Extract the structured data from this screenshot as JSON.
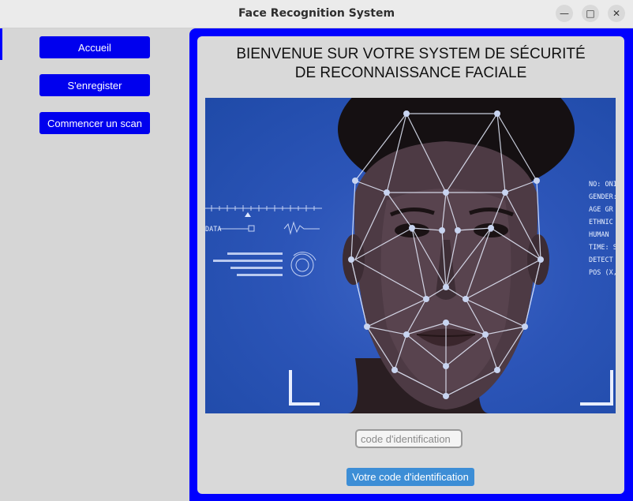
{
  "window": {
    "title": "Face Recognition System",
    "controls": [
      "minimize-icon",
      "maximize-icon",
      "close-icon"
    ]
  },
  "sidebar": {
    "items": [
      {
        "label": "Accueil"
      },
      {
        "label": "S'enregister"
      },
      {
        "label": "Commencer un scan"
      }
    ]
  },
  "main": {
    "heading_line1": "BIENVENUE SUR VOTRE SYSTEM DE SÉCURITÉ",
    "heading_line2": "DE RECONNAISSANCE FACIALE",
    "image": {
      "hud_right": [
        "NO: ONI",
        "GENDER:",
        "AGE GR",
        "ETHNIC",
        "HUMAN",
        "TIME: S",
        "DETECT",
        "POS (X,"
      ],
      "hud_left_label": "DATA"
    },
    "code_input": {
      "placeholder": "code d'identification",
      "value": ""
    },
    "submit_label": "Votre code d'identification"
  },
  "colors": {
    "nav_button": "#0000ee",
    "frame": "#0000ff",
    "submit_button": "#3d8ed6"
  }
}
